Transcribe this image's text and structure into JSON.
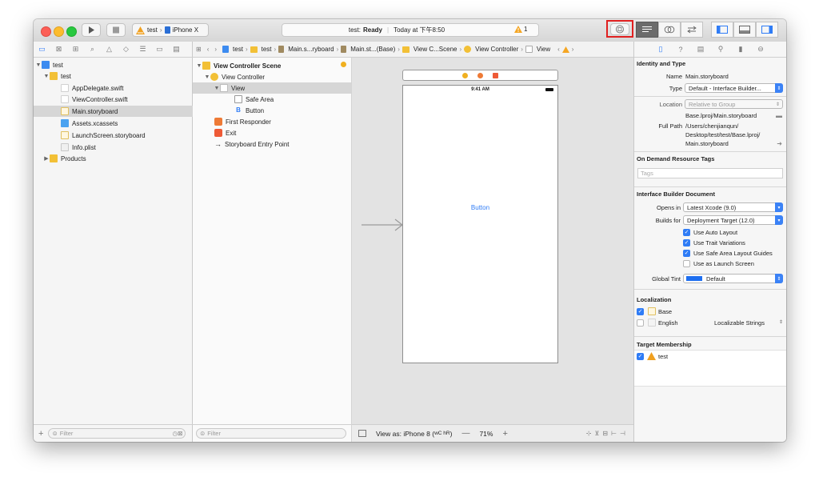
{
  "toolbar": {
    "scheme_project": "test",
    "scheme_device": "iPhone X",
    "status_label": "test:",
    "status_state": "Ready",
    "status_time": "Today at 下午8:50",
    "warning_count": "1"
  },
  "jumpbar": {
    "items": [
      "test",
      "test",
      "Main.s...ryboard",
      "Main.st...(Base)",
      "View C...Scene",
      "View Controller",
      "View"
    ]
  },
  "navigator": {
    "items": [
      {
        "label": "test"
      },
      {
        "label": "test"
      },
      {
        "label": "AppDelegate.swift"
      },
      {
        "label": "ViewController.swift"
      },
      {
        "label": "Main.storyboard"
      },
      {
        "label": "Assets.xcassets"
      },
      {
        "label": "LaunchScreen.storyboard"
      },
      {
        "label": "Info.plist"
      },
      {
        "label": "Products"
      }
    ],
    "filter_placeholder": "Filter"
  },
  "outline": {
    "items": [
      {
        "label": "View Controller Scene"
      },
      {
        "label": "View Controller"
      },
      {
        "label": "View"
      },
      {
        "label": "Safe Area"
      },
      {
        "label": "Button"
      },
      {
        "label": "First Responder"
      },
      {
        "label": "Exit"
      },
      {
        "label": "Storyboard Entry Point"
      }
    ],
    "filter_placeholder": "Filter"
  },
  "canvas": {
    "status_time": "9:41 AM",
    "button_label": "Button",
    "view_as": "View as: iPhone 8 (",
    "view_as_traits": "wC hR",
    "view_as_end": ")",
    "zoom": "71%"
  },
  "inspector": {
    "identity_header": "Identity and Type",
    "name_label": "Name",
    "name_value": "Main.storyboard",
    "type_label": "Type",
    "type_value": "Default - Interface Builder...",
    "location_label": "Location",
    "location_value": "Relative to Group",
    "location_path": "Base.lproj/Main.storyboard",
    "fullpath_label": "Full Path",
    "fullpath_line1": "/Users/chenjianqun/",
    "fullpath_line2": "Desktop/test/test/Base.lproj/",
    "fullpath_line3": "Main.storyboard",
    "odr_header": "On Demand Resource Tags",
    "tags_placeholder": "Tags",
    "ibdoc_header": "Interface Builder Document",
    "opens_label": "Opens in",
    "opens_value": "Latest Xcode (9.0)",
    "builds_label": "Builds for",
    "builds_value": "Deployment Target (12.0)",
    "cb_autolayout": "Use Auto Layout",
    "cb_traits": "Use Trait Variations",
    "cb_safearea": "Use Safe Area Layout Guides",
    "cb_launch": "Use as Launch Screen",
    "tint_label": "Global Tint",
    "tint_value": "Default",
    "tint_color": "#1e6ff0",
    "loc_header": "Localization",
    "loc_base": "Base",
    "loc_english": "English",
    "loc_english_value": "Localizable Strings",
    "membership_header": "Target Membership",
    "membership_target": "test"
  },
  "colors": {
    "accent": "#2f7cf6",
    "warning": "#f5a623",
    "highlight_box": "#e02020"
  }
}
